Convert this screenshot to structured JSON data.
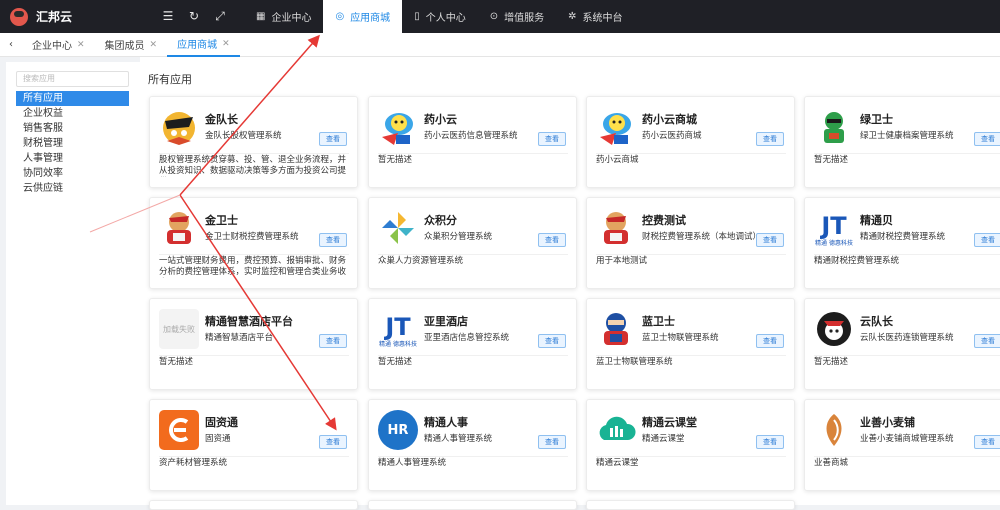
{
  "brand": {
    "name": "汇邦云"
  },
  "topnav": [
    {
      "label": "企业中心",
      "icon": "building-icon",
      "active": false
    },
    {
      "label": "应用商城",
      "icon": "app-store-icon",
      "active": true
    },
    {
      "label": "个人中心",
      "icon": "phone-icon",
      "active": false
    },
    {
      "label": "增值服务",
      "icon": "value-icon",
      "active": false
    },
    {
      "label": "系统中台",
      "icon": "settings-icon",
      "active": false
    }
  ],
  "tabs": [
    {
      "label": "企业中心",
      "active": false
    },
    {
      "label": "集团成员",
      "active": false
    },
    {
      "label": "应用商城",
      "active": true
    }
  ],
  "sidebar": {
    "search_placeholder": "搜索应用",
    "categories": [
      "所有应用",
      "企业权益",
      "销售客服",
      "财税管理",
      "人事管理",
      "协同效率",
      "云供应链"
    ]
  },
  "section_title": "所有应用",
  "view_label": "查看",
  "apps": [
    {
      "title": "金队长",
      "subtitle": "金队长股权管理系统",
      "desc": "股权管理系统贯穿募、投、管、退全业务流程，并从投资知识、数据驱动决策等多方面为投资公司提供...",
      "logo": "warrior-logo"
    },
    {
      "title": "药小云",
      "subtitle": "药小云医药信息管理系统",
      "desc": "暂无描述",
      "logo": "cloud-mascot-logo"
    },
    {
      "title": "药小云商城",
      "subtitle": "药小云医药商城",
      "desc": "药小云商城",
      "logo": "cloud-mascot-logo"
    },
    {
      "title": "绿卫士",
      "subtitle": "绿卫士健康档案管理系统",
      "desc": "暂无描述",
      "logo": "green-guard-logo"
    },
    {
      "title": "金卫士",
      "subtitle": "金卫士财税控费管理系统",
      "desc": "一站式管理财务费用，费控预算、报销审批、财务分析的费控管理体系，实时监控和管理合类业务收支...",
      "logo": "gold-guard-logo"
    },
    {
      "title": "众积分",
      "subtitle": "众巢积分管理系统",
      "desc": "众巢人力资源管理系统",
      "logo": "points-logo"
    },
    {
      "title": "控费测试",
      "subtitle": "财税控费管理系统（本地调试）",
      "desc": "用于本地测试",
      "logo": "gold-guard-logo"
    },
    {
      "title": "精通贝",
      "subtitle": "精通财税控费管理系统",
      "desc": "精通财税控费管理系统",
      "logo": "jt-logo"
    },
    {
      "title": "精通智慧酒店平台",
      "subtitle": "精通智慧酒店平台",
      "desc": "暂无描述",
      "logo": "loading-placeholder",
      "placeholder": "加载失败"
    },
    {
      "title": "亚里酒店",
      "subtitle": "亚里酒店信息管控系统",
      "desc": "暂无描述",
      "logo": "jt-logo"
    },
    {
      "title": "蓝卫士",
      "subtitle": "蓝卫士物联管理系统",
      "desc": "蓝卫士物联管理系统",
      "logo": "blue-guard-logo"
    },
    {
      "title": "云队长",
      "subtitle": "云队长医药连锁管理系统",
      "desc": "暂无描述",
      "logo": "cloud-captain-logo"
    },
    {
      "title": "固资通",
      "subtitle": "固资通",
      "desc": "资产耗材管理系统",
      "logo": "asset-logo"
    },
    {
      "title": "精通人事",
      "subtitle": "精通人事管理系统",
      "desc": "精通人事管理系统",
      "logo": "hr-logo"
    },
    {
      "title": "精通云课堂",
      "subtitle": "精通云课堂",
      "desc": "精通云课堂",
      "logo": "cloud-class-logo"
    },
    {
      "title": "业善小麦铺",
      "subtitle": "业善小麦铺商城管理系统",
      "desc": "业善商城",
      "logo": "wheat-logo"
    }
  ],
  "logo_texts": {
    "jt_caption": "精通 德惠科技",
    "hr": "HR"
  },
  "colors": {
    "accent": "#1e88e5",
    "topbar": "#1f2026",
    "annotation": "#e53935"
  }
}
